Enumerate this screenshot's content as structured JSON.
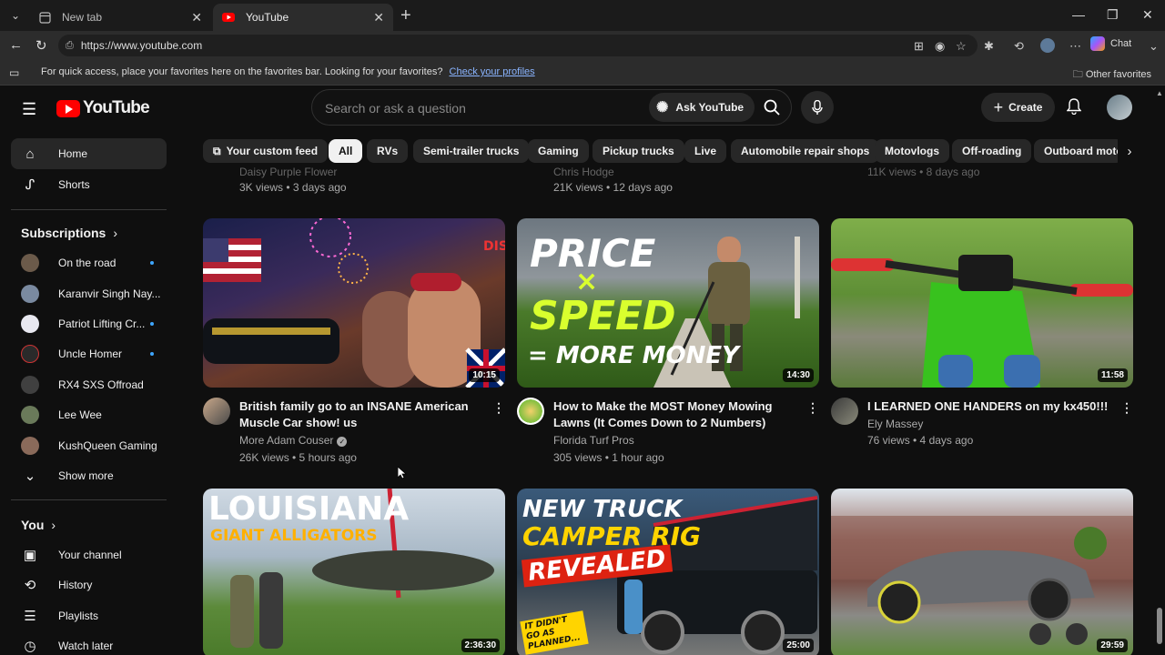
{
  "browser": {
    "tabs": [
      {
        "title": "New tab",
        "active": false
      },
      {
        "title": "YouTube",
        "active": true
      }
    ],
    "url": "https://www.youtube.com",
    "copilot_label": "Chat",
    "favorites_bar": {
      "message": "For quick access, place your favorites here on the favorites bar. Looking for your favorites?",
      "link": "Check your profiles",
      "other_favorites": "Other favorites"
    }
  },
  "masthead": {
    "logo_text": "YouTube",
    "search_placeholder": "Search or ask a question",
    "ask_button": "Ask YouTube",
    "create_label": "Create"
  },
  "sidebar": {
    "main": [
      {
        "label": "Home",
        "icon": "home-icon",
        "active": true
      },
      {
        "label": "Shorts",
        "icon": "shorts-icon",
        "active": false
      }
    ],
    "subscriptions_header": "Subscriptions",
    "subscriptions": [
      {
        "label": "On the road",
        "dot": true,
        "color": "#6b5a4a"
      },
      {
        "label": "Karanvir Singh Nay...",
        "dot": false,
        "color": "#7a8aa0"
      },
      {
        "label": "Patriot Lifting Cr...",
        "dot": true,
        "color": "#e8e8f0"
      },
      {
        "label": "Uncle Homer",
        "dot": true,
        "color": "#2a2a2a"
      },
      {
        "label": "RX4 SXS Offroad",
        "dot": false,
        "color": "#404040"
      },
      {
        "label": "Lee Wee",
        "dot": false,
        "color": "#6a7a5a"
      },
      {
        "label": "KushQueen Gaming",
        "dot": false,
        "color": "#8a6a5a"
      }
    ],
    "show_more": "Show more",
    "you_header": "You",
    "you_items": [
      {
        "label": "Your channel",
        "icon": "channel-icon"
      },
      {
        "label": "History",
        "icon": "history-icon"
      },
      {
        "label": "Playlists",
        "icon": "playlists-icon"
      },
      {
        "label": "Watch later",
        "icon": "watch-later-icon"
      }
    ]
  },
  "chips": [
    "Your custom feed",
    "All",
    "RVs",
    "Semi-trailer trucks",
    "Gaming",
    "Pickup trucks",
    "Live",
    "Automobile repair shops",
    "Motovlogs",
    "Off-roading",
    "Outboard motor"
  ],
  "partial_row": [
    {
      "channel": "Daisy Purple Flower",
      "stats": "3K views • 3 days ago"
    },
    {
      "channel": "Chris Hodge",
      "stats": "21K views • 12 days ago"
    },
    {
      "channel": "",
      "stats": "11K views • 8 days ago"
    }
  ],
  "videos": [
    {
      "title": "British family go to an INSANE American Muscle Car show! us",
      "channel": "More Adam Couser",
      "verified": true,
      "stats": "26K views • 5 hours ago",
      "duration": "10:15"
    },
    {
      "title": "How to Make the MOST Money Mowing Lawns (It Comes Down to 2 Numbers)",
      "channel": "Florida Turf Pros",
      "verified": false,
      "stats": "305 views • 1 hour ago",
      "duration": "14:30",
      "thumb_text": [
        "PRICE",
        "×",
        "SPEED",
        "= MORE MONEY"
      ]
    },
    {
      "title": "I LEARNED ONE HANDERS on my kx450!!!",
      "channel": "Ely Massey",
      "verified": false,
      "stats": "76 views • 4 days ago",
      "duration": "11:58"
    },
    {
      "duration": "2:36:30",
      "thumb_text": [
        "LOUISIANA",
        "GIANT ALLIGATORS"
      ]
    },
    {
      "duration": "25:00",
      "thumb_text": [
        "NEW TRUCK",
        "CAMPER RIG",
        "REVEALED",
        "IT DIDN'T GO AS PLANNED..."
      ]
    },
    {
      "duration": "29:59"
    }
  ]
}
